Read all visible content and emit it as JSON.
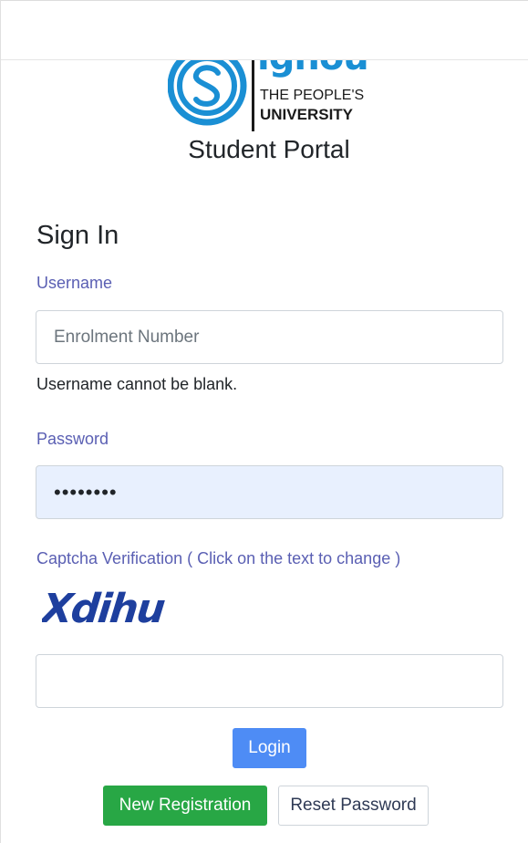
{
  "logo": {
    "word": "ignou",
    "tagline_line1": "THE PEOPLE'S",
    "tagline_line2": "UNIVERSITY",
    "brand_color": "#1a8fd4"
  },
  "portal_title": "Student Portal",
  "signin": {
    "heading": "Sign In",
    "username_label": "Username",
    "username_placeholder": "Enrolment Number",
    "username_value": "",
    "username_error": "Username cannot be blank.",
    "password_label": "Password",
    "password_value": "••••••••",
    "captcha_label": "Captcha Verification ( Click on the text to change )",
    "captcha_text": "Xdihu",
    "captcha_input_value": ""
  },
  "buttons": {
    "login": "Login",
    "new_registration": "New Registration",
    "reset_password": "Reset Password"
  },
  "colors": {
    "label": "#5a5fb3",
    "login_button": "#4e8cf5",
    "register_button": "#28a745",
    "password_autofill_bg": "#e8f0fe"
  }
}
